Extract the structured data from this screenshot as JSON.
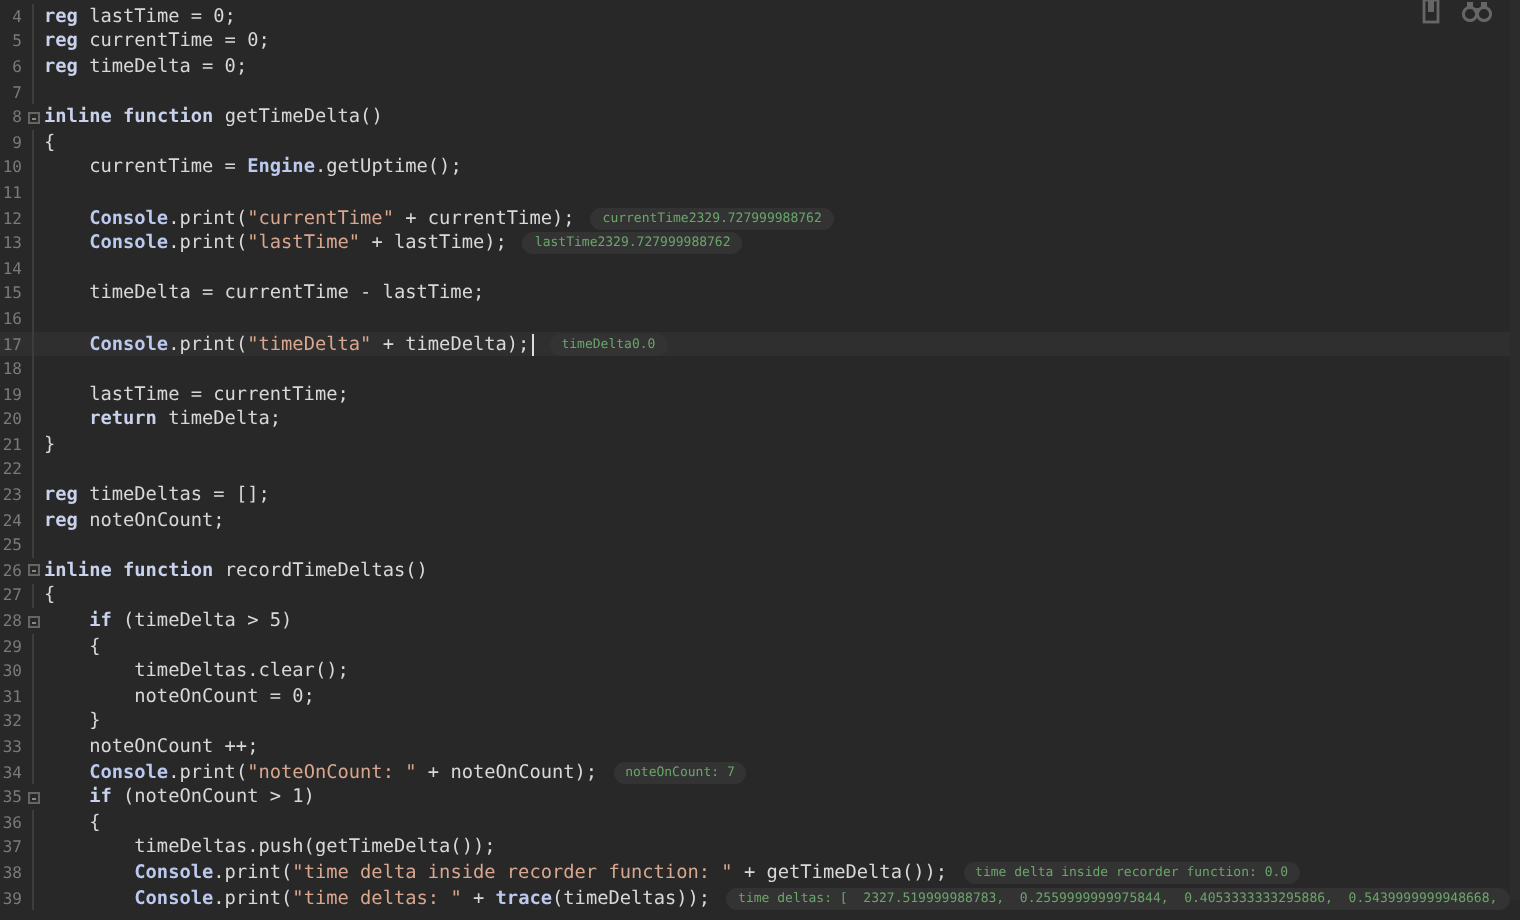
{
  "toolbar": {
    "icons": [
      {
        "kind": "device"
      },
      {
        "kind": "binoculars"
      }
    ]
  },
  "lines": [
    {
      "number": "4",
      "kind": "top",
      "tokens": [
        {
          "kind": "keyword",
          "text": "reg"
        },
        {
          "kind": "plain",
          "text": " lastTime = 0;"
        }
      ]
    },
    {
      "number": "5",
      "kind": "top",
      "tokens": [
        {
          "kind": "keyword",
          "text": "reg"
        },
        {
          "kind": "plain",
          "text": " currentTime = 0;"
        }
      ]
    },
    {
      "number": "6",
      "kind": "top",
      "tokens": [
        {
          "kind": "keyword",
          "text": "reg"
        },
        {
          "kind": "plain",
          "text": " timeDelta = 0;"
        }
      ]
    },
    {
      "number": "7"
    },
    {
      "number": "8",
      "kind": "top",
      "fold": true,
      "tokens": [
        {
          "kind": "keyword",
          "text": "inline function"
        },
        {
          "kind": "plain",
          "text": " getTimeDelta()"
        }
      ]
    },
    {
      "number": "9",
      "kind": "top",
      "tokens": [
        {
          "kind": "plain",
          "text": "{"
        }
      ]
    },
    {
      "number": "10",
      "kind": "block",
      "tokens": [
        {
          "kind": "plain",
          "text": "currentTime = "
        },
        {
          "kind": "api",
          "text": "Engine"
        },
        {
          "kind": "plain",
          "text": ".getUptime();"
        }
      ]
    },
    {
      "number": "11"
    },
    {
      "number": "12",
      "kind": "block",
      "tokens": [
        {
          "kind": "api",
          "text": "Console"
        },
        {
          "kind": "plain",
          "text": ".print("
        },
        {
          "kind": "string",
          "text": "\"currentTime\""
        },
        {
          "kind": "plain",
          "text": " + currentTime);"
        }
      ],
      "inline_value": "currentTime2329.727999988762"
    },
    {
      "number": "13",
      "kind": "block",
      "tokens": [
        {
          "kind": "api",
          "text": "Console"
        },
        {
          "kind": "plain",
          "text": ".print("
        },
        {
          "kind": "string",
          "text": "\"lastTime\""
        },
        {
          "kind": "plain",
          "text": " + lastTime);"
        }
      ],
      "inline_value": "lastTime2329.727999988762"
    },
    {
      "number": "14"
    },
    {
      "number": "15",
      "kind": "block",
      "tokens": [
        {
          "kind": "plain",
          "text": "timeDelta = currentTime - lastTime;"
        }
      ]
    },
    {
      "number": "16"
    },
    {
      "number": "17",
      "kind": "block",
      "current": true,
      "tokens": [
        {
          "kind": "api",
          "text": "Console"
        },
        {
          "kind": "plain",
          "text": ".print("
        },
        {
          "kind": "string",
          "text": "\"timeDelta\""
        },
        {
          "kind": "plain",
          "text": " + timeDelta);"
        }
      ],
      "inline_value": "timeDelta0.0"
    },
    {
      "number": "18"
    },
    {
      "number": "19",
      "kind": "block",
      "tokens": [
        {
          "kind": "plain",
          "text": "lastTime = currentTime;"
        }
      ]
    },
    {
      "number": "20",
      "kind": "block",
      "tokens": [
        {
          "kind": "keyword",
          "text": "return"
        },
        {
          "kind": "plain",
          "text": " timeDelta;"
        }
      ]
    },
    {
      "number": "21",
      "kind": "top",
      "tokens": [
        {
          "kind": "plain",
          "text": "}"
        }
      ]
    },
    {
      "number": "22"
    },
    {
      "number": "23",
      "kind": "top",
      "tokens": [
        {
          "kind": "keyword",
          "text": "reg"
        },
        {
          "kind": "plain",
          "text": " timeDeltas = [];"
        }
      ]
    },
    {
      "number": "24",
      "kind": "top",
      "tokens": [
        {
          "kind": "keyword",
          "text": "reg"
        },
        {
          "kind": "plain",
          "text": " noteOnCount;"
        }
      ]
    },
    {
      "number": "25"
    },
    {
      "number": "26",
      "kind": "top",
      "fold": true,
      "tokens": [
        {
          "kind": "keyword",
          "text": "inline function"
        },
        {
          "kind": "plain",
          "text": " recordTimeDeltas()"
        }
      ]
    },
    {
      "number": "27",
      "kind": "top",
      "tokens": [
        {
          "kind": "plain",
          "text": "{"
        }
      ]
    },
    {
      "number": "28",
      "kind": "block",
      "fold": true,
      "tokens": [
        {
          "kind": "keyword",
          "text": "if"
        },
        {
          "kind": "plain",
          "text": " (timeDelta > 5)"
        }
      ]
    },
    {
      "number": "29",
      "kind": "block",
      "tokens": [
        {
          "kind": "plain",
          "text": "{"
        }
      ]
    },
    {
      "number": "30",
      "kind": "nested",
      "tokens": [
        {
          "kind": "plain",
          "text": "timeDeltas.clear();"
        }
      ]
    },
    {
      "number": "31",
      "kind": "nested",
      "tokens": [
        {
          "kind": "plain",
          "text": "noteOnCount = 0;"
        }
      ]
    },
    {
      "number": "32",
      "kind": "block",
      "tokens": [
        {
          "kind": "plain",
          "text": "}"
        }
      ]
    },
    {
      "number": "33",
      "kind": "block",
      "tokens": [
        {
          "kind": "plain",
          "text": "noteOnCount ++;"
        }
      ]
    },
    {
      "number": "34",
      "kind": "block",
      "tokens": [
        {
          "kind": "api",
          "text": "Console"
        },
        {
          "kind": "plain",
          "text": ".print("
        },
        {
          "kind": "string",
          "text": "\"noteOnCount: \""
        },
        {
          "kind": "plain",
          "text": " + noteOnCount);"
        }
      ],
      "inline_value": "noteOnCount: 7"
    },
    {
      "number": "35",
      "kind": "block",
      "fold": true,
      "tokens": [
        {
          "kind": "keyword",
          "text": "if"
        },
        {
          "kind": "plain",
          "text": " (noteOnCount > 1)"
        }
      ]
    },
    {
      "number": "36",
      "kind": "block",
      "tokens": [
        {
          "kind": "plain",
          "text": "{"
        }
      ]
    },
    {
      "number": "37",
      "kind": "nested",
      "tokens": [
        {
          "kind": "plain",
          "text": "timeDeltas.push(getTimeDelta());"
        }
      ]
    },
    {
      "number": "38",
      "kind": "nested",
      "tokens": [
        {
          "kind": "api",
          "text": "Console"
        },
        {
          "kind": "plain",
          "text": ".print("
        },
        {
          "kind": "string",
          "text": "\"time delta inside recorder function: \""
        },
        {
          "kind": "plain",
          "text": " + getTimeDelta());"
        }
      ],
      "inline_value": "time delta inside recorder function: 0.0"
    },
    {
      "number": "39",
      "kind": "nested",
      "tokens": [
        {
          "kind": "api",
          "text": "Console"
        },
        {
          "kind": "plain",
          "text": ".print("
        },
        {
          "kind": "string",
          "text": "\"time deltas: \""
        },
        {
          "kind": "plain",
          "text": " + "
        },
        {
          "kind": "api",
          "text": "trace"
        },
        {
          "kind": "plain",
          "text": "(timeDeltas));"
        }
      ],
      "inline_value": "time deltas: [  2327.519999988783,  0.2559999999975844,  0.4053333333295886,  0.5439999999948668,"
    }
  ]
}
